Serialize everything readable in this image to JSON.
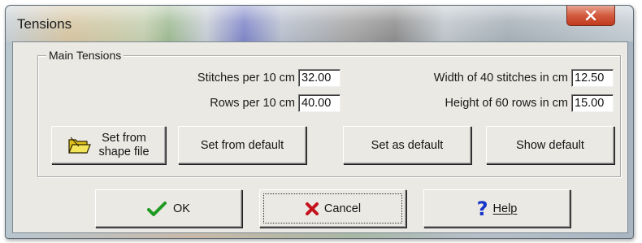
{
  "window": {
    "title": "Tensions",
    "close_icon": "close-icon"
  },
  "main_tensions": {
    "group_label": "Main Tensions",
    "stitches_label": "Stitches per 10 cm",
    "stitches_value": "32.00",
    "rows_label": "Rows per 10 cm",
    "rows_value": "40.00",
    "width_label": "Width of 40 stitches in cm",
    "width_value": "12.50",
    "height_label": "Height of 60 rows in cm",
    "height_value": "15.00"
  },
  "action_buttons": {
    "set_from_shape_line1": "Set from",
    "set_from_shape_line2": "shape file",
    "set_from_shape_icon": "folder-icon",
    "set_from_default": "Set from default",
    "set_as_default": "Set as default",
    "show_default": "Show default"
  },
  "dialog_buttons": {
    "ok": "OK",
    "ok_icon": "checkmark-icon",
    "cancel": "Cancel",
    "cancel_icon": "x-icon",
    "help": "Help",
    "help_icon": "question-mark-icon"
  },
  "colors": {
    "ok_check": "#1f9a22",
    "cancel_x": "#c4121b",
    "help_q": "#1636c8",
    "close_red": "#c9472a"
  }
}
